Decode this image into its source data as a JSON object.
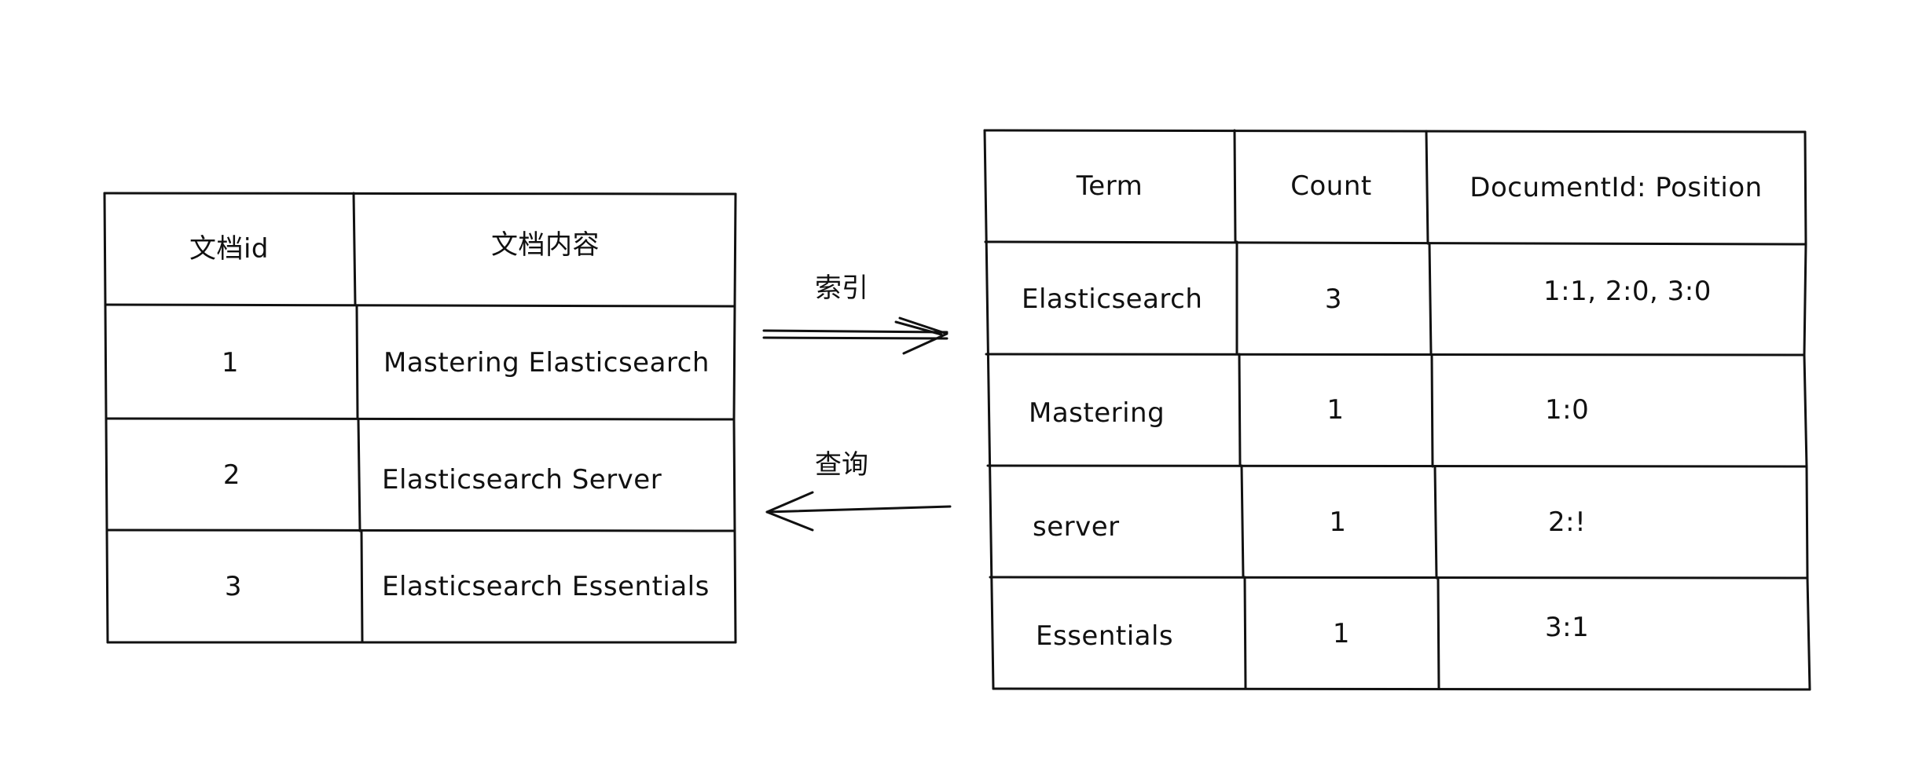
{
  "documents_table": {
    "headers": [
      "文档id",
      "文档内容"
    ],
    "rows": [
      {
        "id": "1",
        "content": "Mastering Elasticsearch"
      },
      {
        "id": "2",
        "content": "Elasticsearch Server"
      },
      {
        "id": "3",
        "content": "Elasticsearch Essentials"
      }
    ]
  },
  "index_table": {
    "headers": [
      "Term",
      "Count",
      "DocumentId: Position"
    ],
    "rows": [
      {
        "term": "Elasticsearch",
        "count": "3",
        "positions": "1:1, 2:0, 3:0"
      },
      {
        "term": "Mastering",
        "count": "1",
        "positions": "1:0"
      },
      {
        "term": "server",
        "count": "1",
        "positions": "2:!"
      },
      {
        "term": "Essentials",
        "count": "1",
        "positions": "3:1"
      }
    ]
  },
  "arrows": {
    "index_label": "索引",
    "query_label": "查询"
  },
  "colors": {
    "stroke": "#111111",
    "background": "#ffffff"
  }
}
